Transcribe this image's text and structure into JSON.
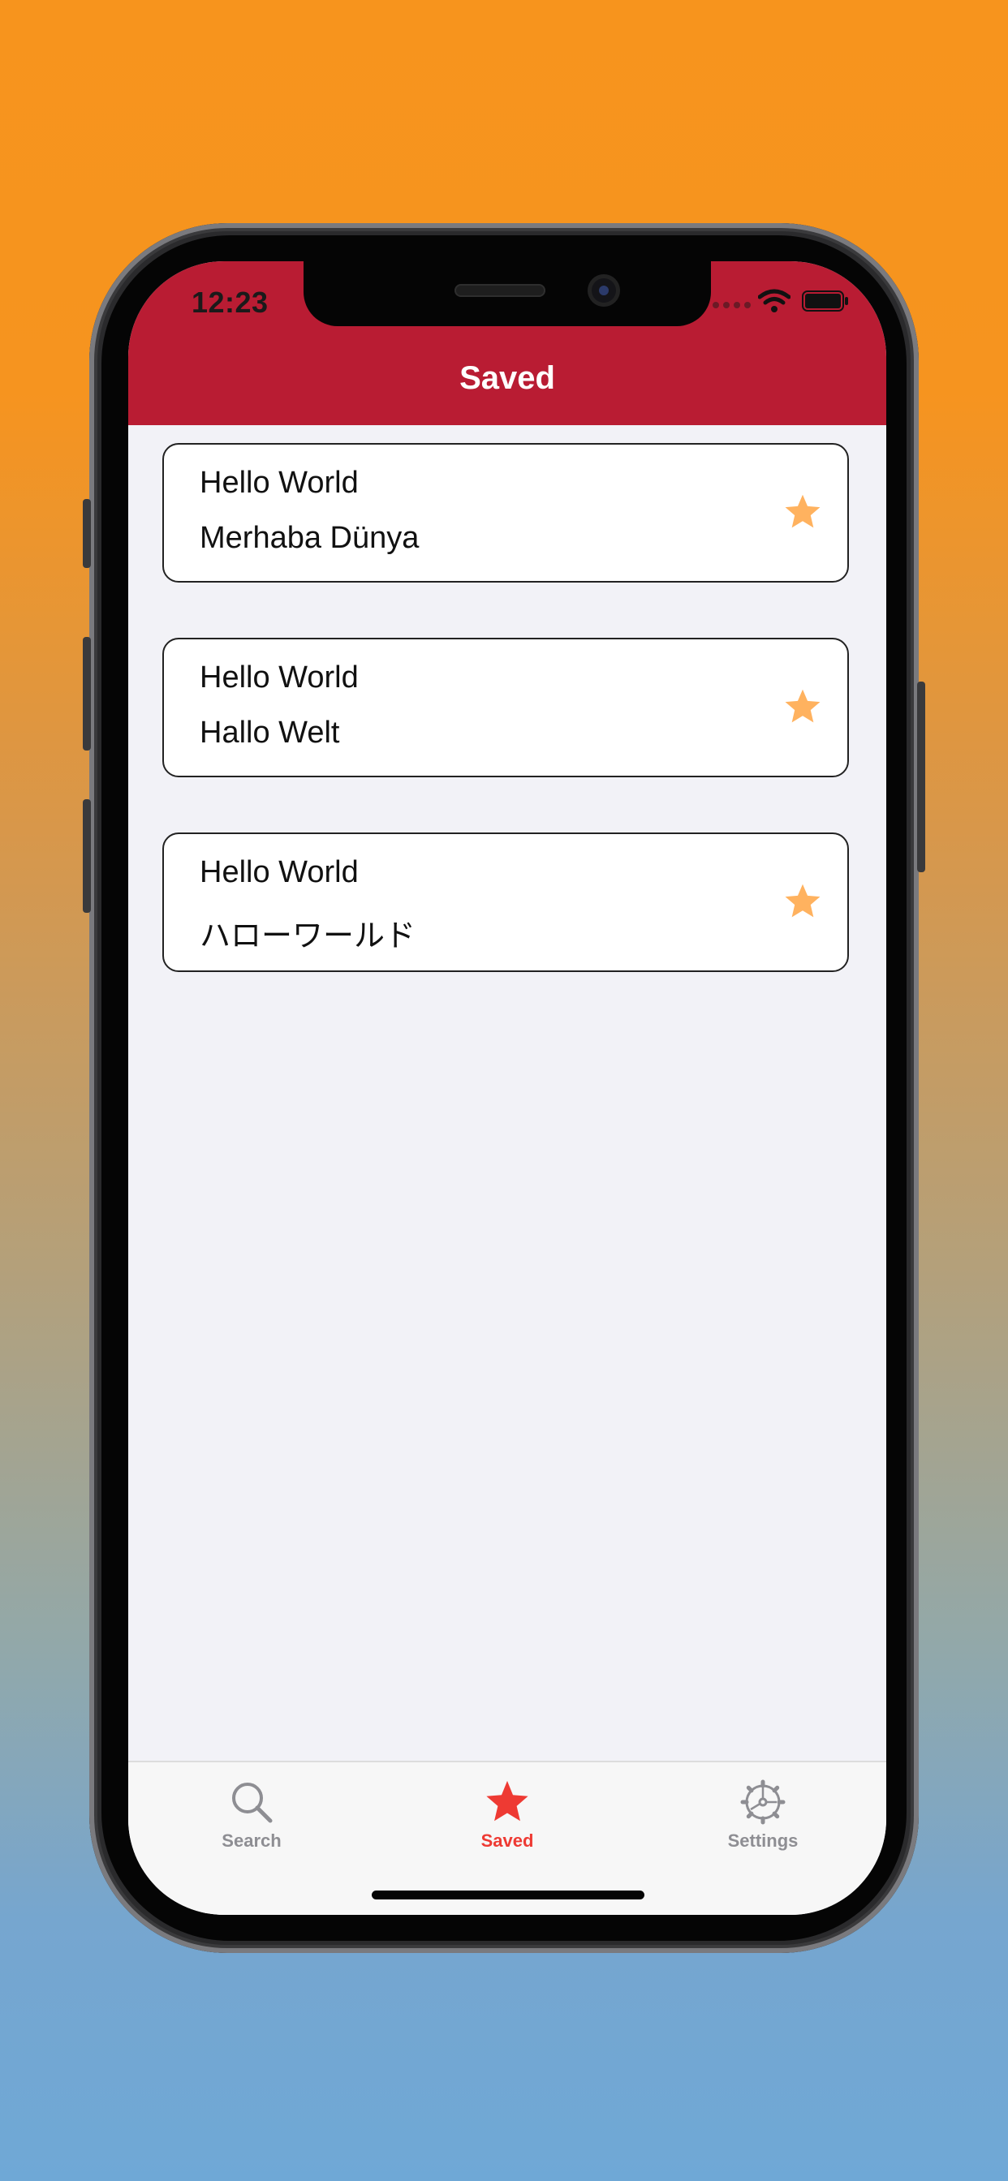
{
  "status_bar": {
    "time": "12:23"
  },
  "header": {
    "title": "Saved",
    "background_color": "#b91c33"
  },
  "saved_items": [
    {
      "source": "Hello World",
      "translation": "Merhaba Dünya",
      "starred": true
    },
    {
      "source": "Hello World",
      "translation": "Hallo Welt",
      "starred": true
    },
    {
      "source": "Hello World",
      "translation": "ハローワールド",
      "starred": true
    }
  ],
  "star_color": "#ffb25f",
  "tabbar": {
    "active_color": "#ee3a33",
    "inactive_color": "#8e8e93",
    "tabs": [
      {
        "label": "Search",
        "icon": "search-icon",
        "active": false
      },
      {
        "label": "Saved",
        "icon": "star-icon",
        "active": true
      },
      {
        "label": "Settings",
        "icon": "gear-icon",
        "active": false
      }
    ]
  }
}
